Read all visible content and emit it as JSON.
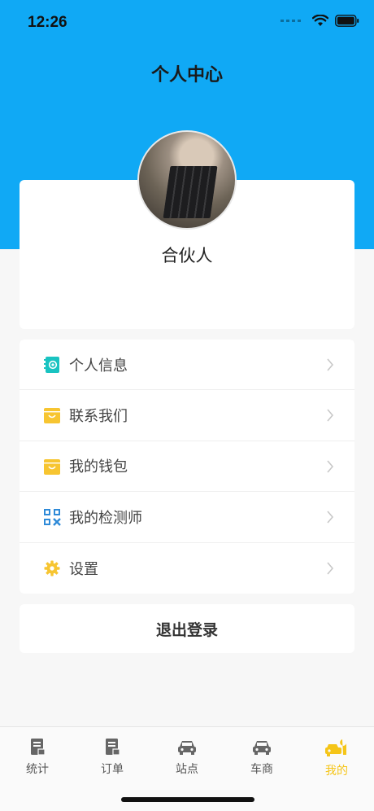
{
  "status": {
    "time": "12:26"
  },
  "header": {
    "title": "个人中心"
  },
  "profile": {
    "name": "合伙人"
  },
  "menu": [
    {
      "label": "个人信息",
      "icon": "contact-book-icon",
      "color": "#19c3c1"
    },
    {
      "label": "联系我们",
      "icon": "shopping-bag-icon",
      "color": "#f7c531"
    },
    {
      "label": "我的钱包",
      "icon": "wallet-bag-icon",
      "color": "#f7c531"
    },
    {
      "label": "我的检测师",
      "icon": "qr-code-icon",
      "color": "#2e8ad8"
    },
    {
      "label": "设置",
      "icon": "gear-icon",
      "color": "#f7c531"
    }
  ],
  "logout": {
    "label": "退出登录"
  },
  "tabs": [
    {
      "label": "统计",
      "icon": "stats-doc-icon",
      "active": false
    },
    {
      "label": "订单",
      "icon": "order-doc-icon",
      "active": false
    },
    {
      "label": "站点",
      "icon": "car-station-icon",
      "active": false
    },
    {
      "label": "车商",
      "icon": "car-dealer-icon",
      "active": false
    },
    {
      "label": "我的",
      "icon": "mine-car-wrench-icon",
      "active": true
    }
  ],
  "colors": {
    "header": "#10a9f5",
    "active_tab": "#f5c518",
    "background": "#f7f7f7"
  }
}
